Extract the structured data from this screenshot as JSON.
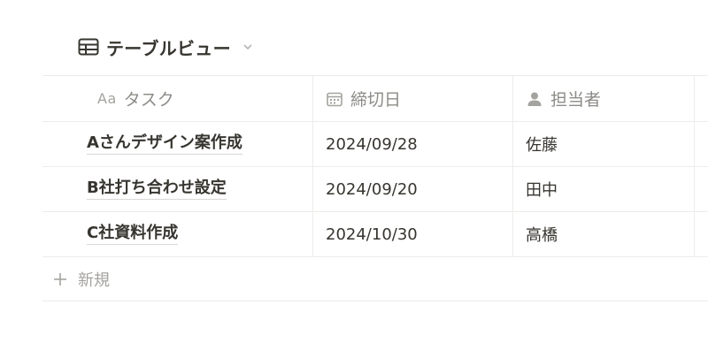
{
  "view": {
    "title": "テーブルビュー",
    "icon": "table-icon",
    "dropdown_icon": "chevron-down-icon"
  },
  "columns": [
    {
      "icon": "text-type-icon",
      "icon_text": "Aa",
      "label": "タスク"
    },
    {
      "icon": "calendar-icon",
      "label": "締切日"
    },
    {
      "icon": "person-icon",
      "label": "担当者"
    }
  ],
  "rows": [
    {
      "task": "Aさんデザイン案作成",
      "deadline": "2024/09/28",
      "assignee": "佐藤"
    },
    {
      "task": "B社打ち合わせ設定",
      "deadline": "2024/09/20",
      "assignee": "田中"
    },
    {
      "task": "C社資料作成",
      "deadline": "2024/10/30",
      "assignee": "高橋"
    }
  ],
  "new_row": {
    "icon": "plus-icon",
    "label": "新規"
  },
  "colors": {
    "text": "#37352f",
    "muted": "#8c8b87",
    "border": "#ececea"
  }
}
